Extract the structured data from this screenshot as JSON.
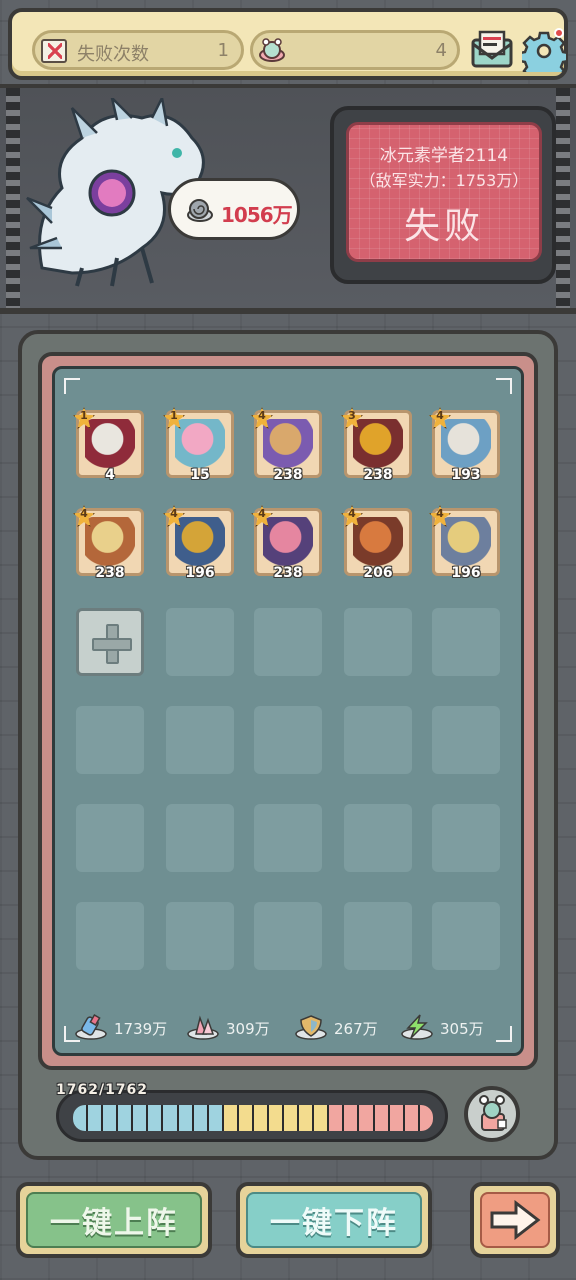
{
  "topbar": {
    "fail_label": "失败次数",
    "fail_count": "1",
    "snail_count": "4",
    "icons": [
      "fail-scroll-icon",
      "snail-icon",
      "mail-icon",
      "gear-icon"
    ]
  },
  "scene": {
    "player_power": "1056万"
  },
  "enemy": {
    "name": "冰元素学者2114",
    "power": "（敌军实力：1753万）",
    "result": "失败"
  },
  "heroes": [
    {
      "star": "1",
      "level": "4",
      "colors": [
        "#e9e6df",
        "#8f2b3a"
      ]
    },
    {
      "star": "1",
      "level": "15",
      "colors": [
        "#f2a8c4",
        "#74b7c9"
      ]
    },
    {
      "star": "4",
      "level": "238",
      "colors": [
        "#d9a86c",
        "#7b5bb0"
      ]
    },
    {
      "star": "3",
      "level": "238",
      "colors": [
        "#e0a32a",
        "#7a2f2f"
      ]
    },
    {
      "star": "4",
      "level": "193",
      "colors": [
        "#e6e2da",
        "#6da0c4"
      ]
    },
    {
      "star": "4",
      "level": "238",
      "colors": [
        "#e9d08b",
        "#b4673a"
      ]
    },
    {
      "star": "4",
      "level": "196",
      "colors": [
        "#d4a438",
        "#3f5e8c"
      ]
    },
    {
      "star": "4",
      "level": "238",
      "colors": [
        "#e586a0",
        "#55417a"
      ]
    },
    {
      "star": "4",
      "level": "206",
      "colors": [
        "#d87a3f",
        "#7a3b2a"
      ]
    },
    {
      "star": "4",
      "level": "196",
      "colors": [
        "#e5cc7d",
        "#6d7f9e"
      ]
    }
  ],
  "stats": [
    {
      "icon": "potion-icon",
      "value": "1739万"
    },
    {
      "icon": "crystal-icon",
      "value": "309万"
    },
    {
      "icon": "shield-icon",
      "value": "267万"
    },
    {
      "icon": "lightning-icon",
      "value": "305万"
    }
  ],
  "energy": {
    "text": "1762/1762",
    "fraction": 1.0,
    "segment_colors": [
      "#9fd3e0",
      "#9fd3e0",
      "#9fd3e0",
      "#9fd3e0",
      "#9fd3e0",
      "#9fd3e0",
      "#9fd3e0",
      "#9fd3e0",
      "#9fd3e0",
      "#9fd3e0",
      "#f3dc8e",
      "#f3dc8e",
      "#f3dc8e",
      "#f3dc8e",
      "#f3dc8e",
      "#f3dc8e",
      "#f3dc8e",
      "#f1a6a0",
      "#f1a6a0",
      "#f1a6a0",
      "#f1a6a0",
      "#f1a6a0",
      "#f1a6a0",
      "#f1a6a0"
    ]
  },
  "buttons": {
    "deploy_all": "一键上阵",
    "remove_all": "一键下阵",
    "next": "next-arrow-icon"
  }
}
